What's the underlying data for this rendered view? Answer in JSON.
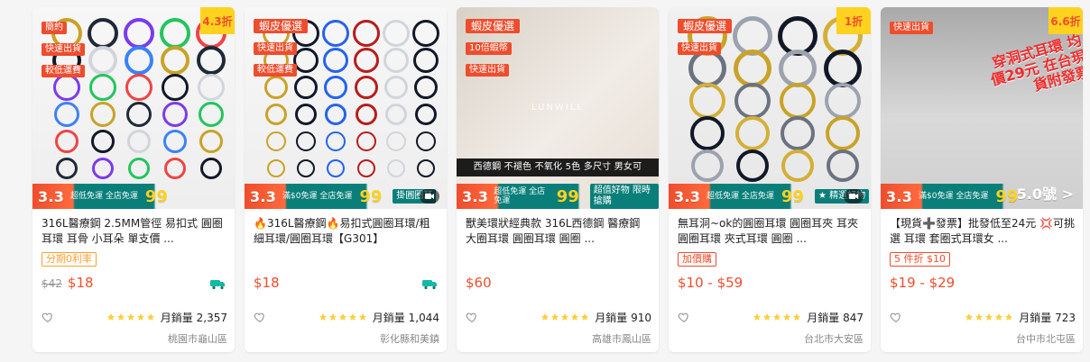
{
  "products": [
    {
      "discount": "4.3折",
      "tags": [
        "簡約",
        "快速出貨",
        "較低運費"
      ],
      "promo": {
        "day": "3.3",
        "free_line": "超低免運 全店免運",
        "n99": "99"
      },
      "name": "316L醫療鋼 2.5MM管徑 易扣式 圓圈耳環 耳骨 小耳朵 單支價 ...",
      "sub_tag": "分期0利率",
      "sub_tag_style": "orange",
      "old_price": "$42",
      "price": "$18",
      "sales_label": "月銷量",
      "sales": "2,357",
      "location": "桃園市龜山區",
      "has_free_ship_icon": true
    },
    {
      "discount": "",
      "tags": [
        "蝦皮優選",
        "快速出貨",
        "較低運費"
      ],
      "promo": {
        "day": "3.3",
        "free_line": "滿$0免運 全店免運",
        "n99": "99",
        "extra": "掛圓圈耳"
      },
      "name": "🔥316L醫療鋼🔥易扣式圓圈耳環/粗細耳環/圓圈耳環【G301】",
      "old_price": "",
      "price": "$18",
      "sales_label": "月銷量",
      "sales": "1,044",
      "location": "彰化縣和美鎮",
      "has_free_ship_icon": true,
      "has_video_icon": true
    },
    {
      "discount": "",
      "tags": [
        "蝦皮優選",
        "10倍蝦幣",
        "快速出貨"
      ],
      "promo": {
        "day": "3.3",
        "free_line": "超低免運 全店免運",
        "n99": "99",
        "extra": "超值好物 限時搶購"
      },
      "overlay": "西德鋼  不褪色  不氧化  5色  多尺寸  男女可",
      "brand_text": "LUNWILL",
      "name": "獸美環狀經典款 316L西德鋼 醫療鋼 大圈耳環 圓圈耳環 圓圈 ...",
      "old_price": "",
      "price": "$60",
      "sales_label": "月銷量",
      "sales": "910",
      "location": "高雄市鳳山區"
    },
    {
      "discount": "1折",
      "tags": [
        "蝦皮優選",
        "快速出貨"
      ],
      "promo": {
        "day": "3.3",
        "free_line": "超低免運 全店免運",
        "n99": "99",
        "extra": "★ 精選好物"
      },
      "name": "無耳洞~ok的圓圈耳環 圓圈耳夾 耳夾 圓圈耳環 夾式耳環 圓圈 ...",
      "sub_tag": "加價購",
      "sub_tag_style": "red",
      "old_price": "",
      "price": "$10 - $59",
      "sales_label": "月銷量",
      "sales": "847",
      "location": "台北市大安區",
      "has_video_icon": true
    },
    {
      "discount": "6.6折",
      "tags": [
        "快速出貨"
      ],
      "promo": {
        "day": "3.3",
        "free_line": "滿$0免運 全店免運",
        "n99": "99",
        "extra": "5.0號 >"
      },
      "red_title": "穿洞式耳環 均價29元 在台現貨附發票",
      "name": "【現貨➕發票】批發低至24元 💢可挑選 耳環 套圈式耳環女 ...",
      "sub_tag": "5 件折 $10",
      "sub_tag_style": "red",
      "old_price": "",
      "price": "$19 - $29",
      "sales_label": "月銷量",
      "sales": "723",
      "location": "台中市北屯區"
    }
  ]
}
